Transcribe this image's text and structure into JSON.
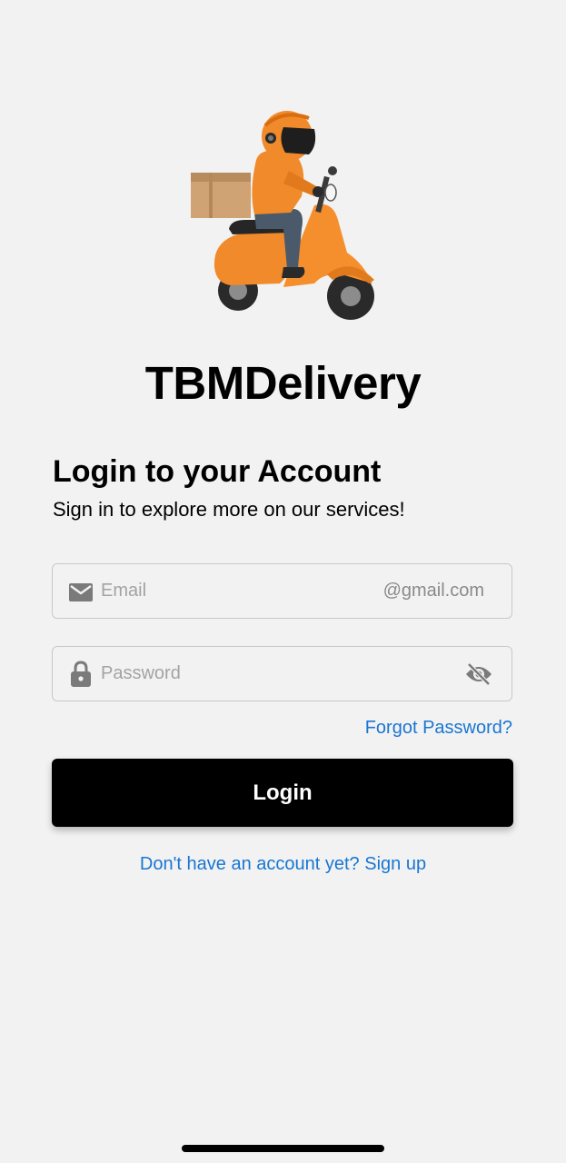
{
  "app": {
    "title": "TBMDelivery"
  },
  "login": {
    "heading": "Login to your Account",
    "subheading": "Sign in to explore more on our services!",
    "email": {
      "placeholder": "Email",
      "value": "",
      "suffix": "@gmail.com",
      "icon": "mail-icon"
    },
    "password": {
      "placeholder": "Password",
      "value": "",
      "icon": "lock-icon",
      "toggle_icon": "eye-off-icon"
    },
    "forgot_label": "Forgot Password?",
    "button_label": "Login",
    "signup_label": "Don't have an account yet? Sign up"
  },
  "colors": {
    "background": "#f2f2f2",
    "primary_button": "#000000",
    "link": "#1976d2",
    "field_border": "#c8c8c8"
  }
}
